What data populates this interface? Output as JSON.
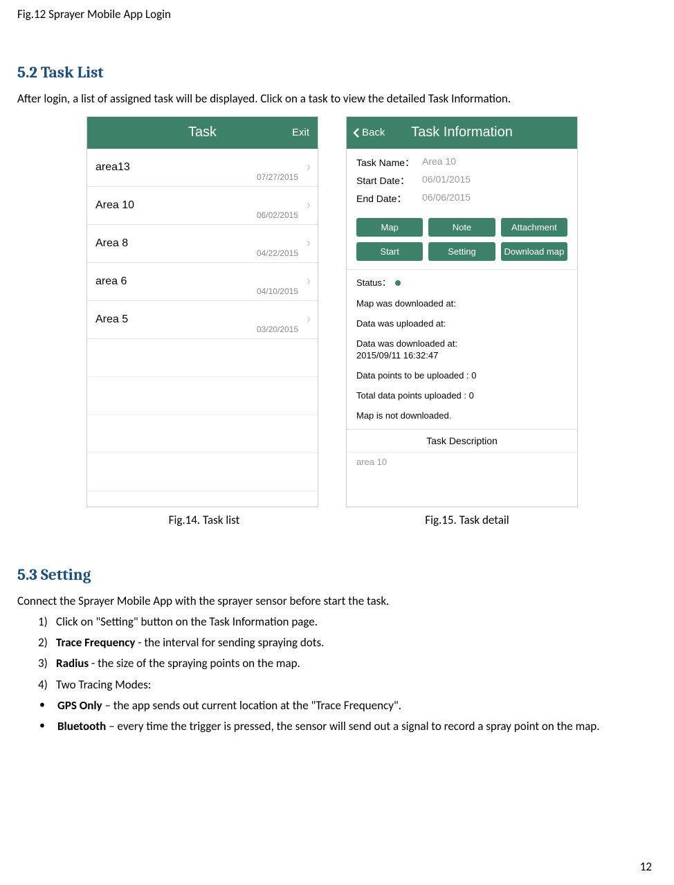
{
  "captionTop": "Fig.12 Sprayer Mobile App Login",
  "section52": {
    "heading": "5.2 Task List",
    "intro": "After login, a list of assigned task will be displayed. Click on a task to view the detailed Task Information."
  },
  "taskListScreen": {
    "title": "Task",
    "exit": "Exit",
    "rows": [
      {
        "name": "area13",
        "date": "07/27/2015"
      },
      {
        "name": "Area 10",
        "date": "06/02/2015"
      },
      {
        "name": "Area 8",
        "date": "04/22/2015"
      },
      {
        "name": "area 6",
        "date": "04/10/2015"
      },
      {
        "name": "Area 5",
        "date": "03/20/2015"
      }
    ]
  },
  "taskInfoScreen": {
    "back": "Back",
    "title": "Task Information",
    "fields": {
      "taskNameLabel": "Task Name：",
      "taskNameVal": "Area 10",
      "startLabel": "Start Date：",
      "startVal": "06/01/2015",
      "endLabel": "End Date：",
      "endVal": "06/06/2015"
    },
    "buttons": {
      "map": "Map",
      "note": "Note",
      "attachment": "Attachment",
      "start": "Start",
      "setting": "Setting",
      "download": "Download map"
    },
    "status": {
      "statusLabel": "Status：",
      "mapDownloaded": "Map was downloaded at:",
      "dataUploaded": "Data was uploaded at:",
      "dataDownloaded": "Data was downloaded at:",
      "dataDownloadedTime": "2015/09/11 16:32:47",
      "toUpload": "Data points to be uploaded : 0",
      "totalUploaded": "Total data points uploaded : 0",
      "mapNot": "Map is not downloaded."
    },
    "descHeader": "Task Description",
    "descBody": "area 10"
  },
  "figCaptions": {
    "left": "Fig.14. Task list",
    "right": "Fig.15. Task detail"
  },
  "section53": {
    "heading": "5.3 Setting",
    "intro": "Connect the Sprayer Mobile App with the sprayer sensor before start the task.",
    "item1": "Click on \"Setting\" button on the Task Information page.",
    "item2a": "Trace Frequency",
    "item2b": " - the interval for sending spraying dots.",
    "item3a": "Radius",
    "item3b": " - the size of the spraying points on the map.",
    "item4": "Two Tracing Modes:",
    "bullet1a": "GPS Only",
    "bullet1b": " – the app sends out current location at the \"Trace Frequency\".",
    "bullet2a": "Bluetooth",
    "bullet2b": " – every time the trigger is pressed, the sensor will send out a signal to record a spray point on the map."
  },
  "pageNumber": "12"
}
